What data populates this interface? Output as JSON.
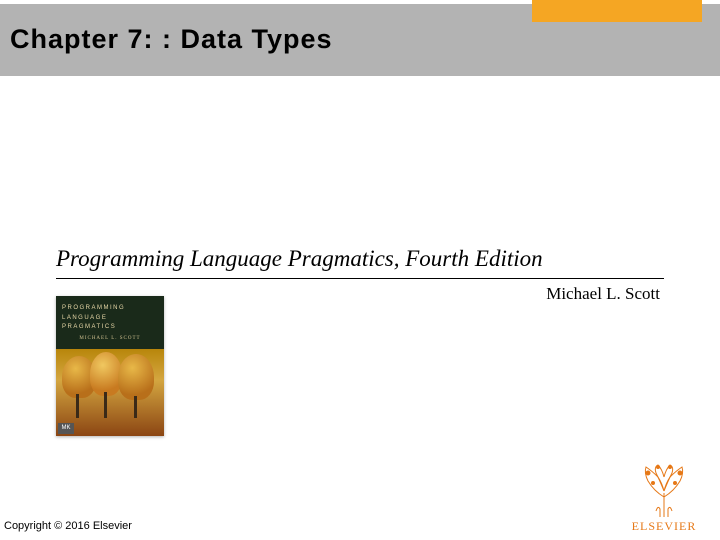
{
  "header": {
    "chapter_title": "Chapter 7: : Data Types"
  },
  "main": {
    "book_title": "Programming Language Pragmatics, Fourth Edition",
    "author": "Michael L. Scott"
  },
  "cover": {
    "line1": "PROGRAMMING",
    "line2": "LANGUAGE",
    "line3": "PRAGMATICS",
    "cover_author": "MICHAEL L. SCOTT",
    "badge": "MK"
  },
  "footer": {
    "copyright": "Copyright © 2016 Elsevier",
    "publisher": "ELSEVIER"
  }
}
